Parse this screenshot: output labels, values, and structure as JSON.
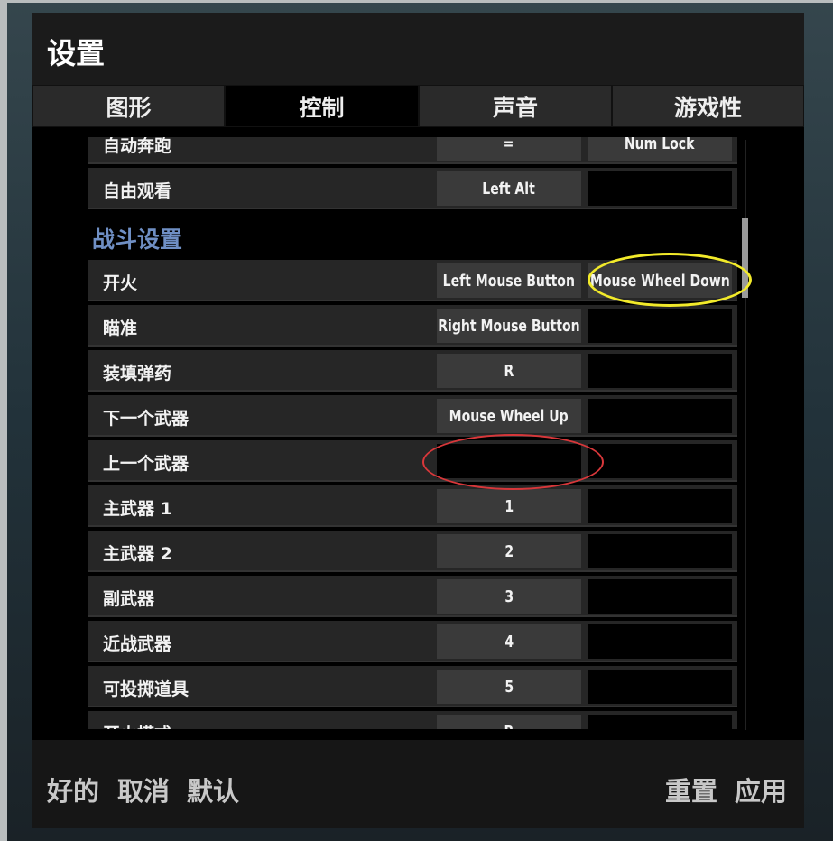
{
  "title": "设置",
  "tabs": [
    {
      "label": "图形",
      "active": false
    },
    {
      "label": "控制",
      "active": true
    },
    {
      "label": "声音",
      "active": false
    },
    {
      "label": "游戏性",
      "active": false
    }
  ],
  "rows_top": [
    {
      "label": "自动奔跑",
      "primary": "=",
      "secondary": "Num Lock"
    },
    {
      "label": "自由观看",
      "primary": "Left Alt",
      "secondary": ""
    }
  ],
  "section": "战斗设置",
  "rows_combat": [
    {
      "label": "开火",
      "primary": "Left Mouse Button",
      "secondary": "Mouse Wheel Down"
    },
    {
      "label": "瞄准",
      "primary": "Right Mouse Button",
      "secondary": ""
    },
    {
      "label": "装填弹药",
      "primary": "R",
      "secondary": ""
    },
    {
      "label": "下一个武器",
      "primary": "Mouse Wheel Up",
      "secondary": ""
    },
    {
      "label": "上一个武器",
      "primary": "",
      "secondary": ""
    },
    {
      "label": "主武器 1",
      "primary": "1",
      "secondary": ""
    },
    {
      "label": "主武器 2",
      "primary": "2",
      "secondary": ""
    },
    {
      "label": "副武器",
      "primary": "3",
      "secondary": ""
    },
    {
      "label": "近战武器",
      "primary": "4",
      "secondary": ""
    },
    {
      "label": "可投掷道具",
      "primary": "5",
      "secondary": ""
    },
    {
      "label": "开火模式",
      "primary": "B",
      "secondary": ""
    }
  ],
  "footer": {
    "ok": "好的",
    "cancel": "取消",
    "default": "默认",
    "reset": "重置",
    "apply": "应用"
  },
  "annotations": {
    "yellow": "#f2ea2a",
    "red": "#d8373a"
  }
}
